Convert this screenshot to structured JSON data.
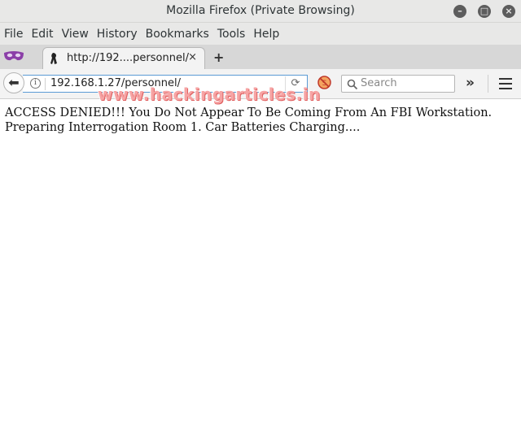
{
  "window": {
    "title": "Mozilla Firefox (Private Browsing)"
  },
  "menu": {
    "items": [
      "File",
      "Edit",
      "View",
      "History",
      "Bookmarks",
      "Tools",
      "Help"
    ]
  },
  "tab": {
    "title": "http://192....personnel/",
    "close": "×",
    "new_tab": "+"
  },
  "navbar": {
    "url": "192.168.1.27/personnel/",
    "search_placeholder": "Search",
    "overflow": "»"
  },
  "page": {
    "message": "ACCESS DENIED!!! You Do Not Appear To Be Coming From An FBI Workstation. Preparing Interrogation Room 1. Car Batteries Charging...."
  },
  "watermark": "www.hackingarticles.in",
  "colors": {
    "chrome": "#e8e8e7",
    "urlbar_focus": "#5b9bd5",
    "private_mask": "#8b3fa8",
    "watermark": "#f6a4a4"
  }
}
